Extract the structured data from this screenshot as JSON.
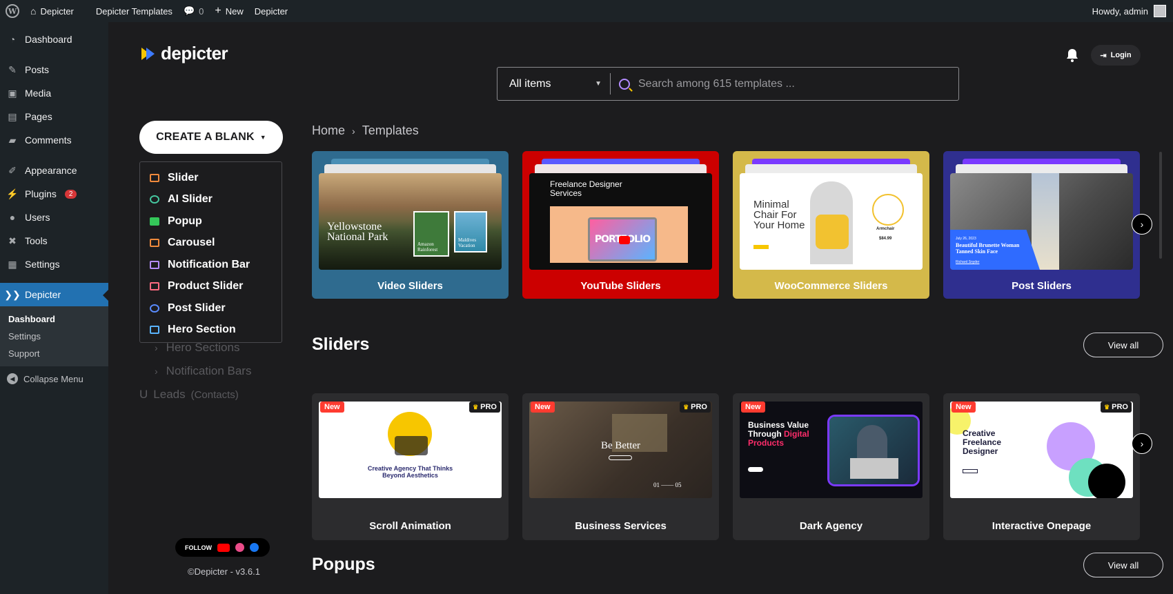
{
  "adminbar": {
    "site_name": "Depicter",
    "templates_link": "Depicter Templates",
    "comments_count": "0",
    "new_label": "New",
    "plugin_link": "Depicter",
    "greeting": "Howdy, admin"
  },
  "wpmenu": {
    "items": [
      {
        "label": "Dashboard",
        "icon": "gauge-icon"
      },
      {
        "label": "Posts",
        "icon": "pin-icon"
      },
      {
        "label": "Media",
        "icon": "media-icon"
      },
      {
        "label": "Pages",
        "icon": "pages-icon"
      },
      {
        "label": "Comments",
        "icon": "comment-icon"
      },
      {
        "label": "Appearance",
        "icon": "brush-icon"
      },
      {
        "label": "Plugins",
        "icon": "plug-icon",
        "badge": "2"
      },
      {
        "label": "Users",
        "icon": "user-icon"
      },
      {
        "label": "Tools",
        "icon": "wrench-icon"
      },
      {
        "label": "Settings",
        "icon": "settings-icon"
      },
      {
        "label": "Depicter",
        "icon": "depicter-icon"
      }
    ],
    "submenu": [
      "Dashboard",
      "Settings",
      "Support"
    ],
    "collapse_label": "Collapse Menu"
  },
  "app": {
    "logo_text": "depicter",
    "search": {
      "filter_value": "All items",
      "placeholder": "Search among 615 templates ..."
    },
    "login_label": "Login",
    "create_label": "CREATE A BLANK",
    "create_menu": [
      {
        "label": "Slider",
        "color": "#f08a3c"
      },
      {
        "label": "AI Slider",
        "color": "#46c8a0"
      },
      {
        "label": "Popup",
        "color": "#34c759"
      },
      {
        "label": "Carousel",
        "color": "#f08a3c"
      },
      {
        "label": "Notification Bar",
        "color": "#b48cff"
      },
      {
        "label": "Product Slider",
        "color": "#ff6b81"
      },
      {
        "label": "Post Slider",
        "color": "#5a8cff"
      },
      {
        "label": "Hero Section",
        "color": "#5ab4ff"
      }
    ],
    "hidden_nav": {
      "hero": "Hero Sections",
      "notif": "Notification Bars",
      "leads": "Leads",
      "leads_sub": "(Contacts)"
    },
    "follow_label": "FOLLOW",
    "version": "©Depicter - v3.6.1",
    "breadcrumb": {
      "home": "Home",
      "current": "Templates"
    },
    "categories": [
      {
        "label": "Video Sliders",
        "color": "#2f6b8f"
      },
      {
        "label": "YouTube Sliders",
        "color": "#cc0000"
      },
      {
        "label": "WooCommerce Sliders",
        "color": "#d4b94a"
      },
      {
        "label": "Post Sliders",
        "color": "#2f2f8f"
      }
    ],
    "cat_shots": {
      "video_title": "Yellowstone National Park",
      "video_tag1": "Amazon Rainforest",
      "video_tag2": "Maldives Vacation",
      "yt_title": "Freelance Designer Services",
      "yt_word": "PORTFOLIO",
      "woo_title": "Minimal Chair For Your Home",
      "woo_product": "Armchair",
      "woo_price": "$84.99",
      "post_title": "Beautiful Brunette Woman Tanned Skin Face",
      "post_date": "July 26, 2023",
      "post_author": "Richard Snyder"
    },
    "sliders_section": {
      "title": "Sliders",
      "view_all": "View all",
      "badge_new": "New",
      "badge_pro": "PRO",
      "templates": [
        {
          "label": "Scroll Animation",
          "headline": "Creative Agency That Thinks Beyond Aesthetics"
        },
        {
          "label": "Business Services",
          "headline": "Be Better",
          "counter": "01 —— 05"
        },
        {
          "label": "Dark Agency",
          "headline": "Business Value Through",
          "headline_accent": "Digital Products"
        },
        {
          "label": "Interactive Onepage",
          "headline": "Creative Freelance Designer"
        }
      ]
    },
    "popups_section": {
      "title": "Popups",
      "view_all": "View all"
    }
  }
}
